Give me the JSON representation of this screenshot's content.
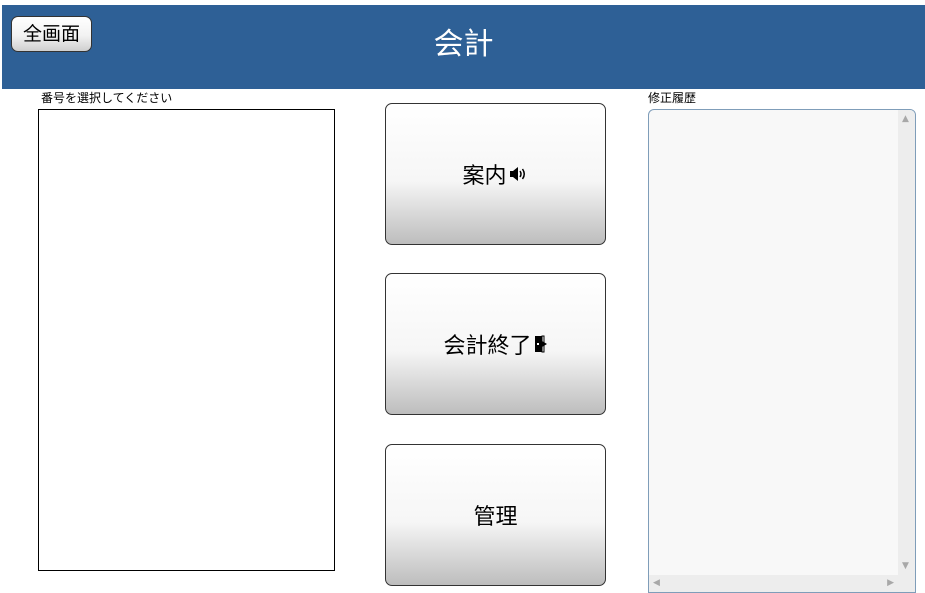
{
  "header": {
    "title": "会計",
    "fullscreen_label": "全画面",
    "background_color": "#2e6096"
  },
  "number_select": {
    "label": "番号を選択してください"
  },
  "actions": {
    "guide_label": "案内",
    "guide_icon": "speaker-icon",
    "end_label": "会計終了",
    "end_icon": "exit-icon",
    "manage_label": "管理"
  },
  "history": {
    "label": "修正履歴",
    "value": ""
  }
}
